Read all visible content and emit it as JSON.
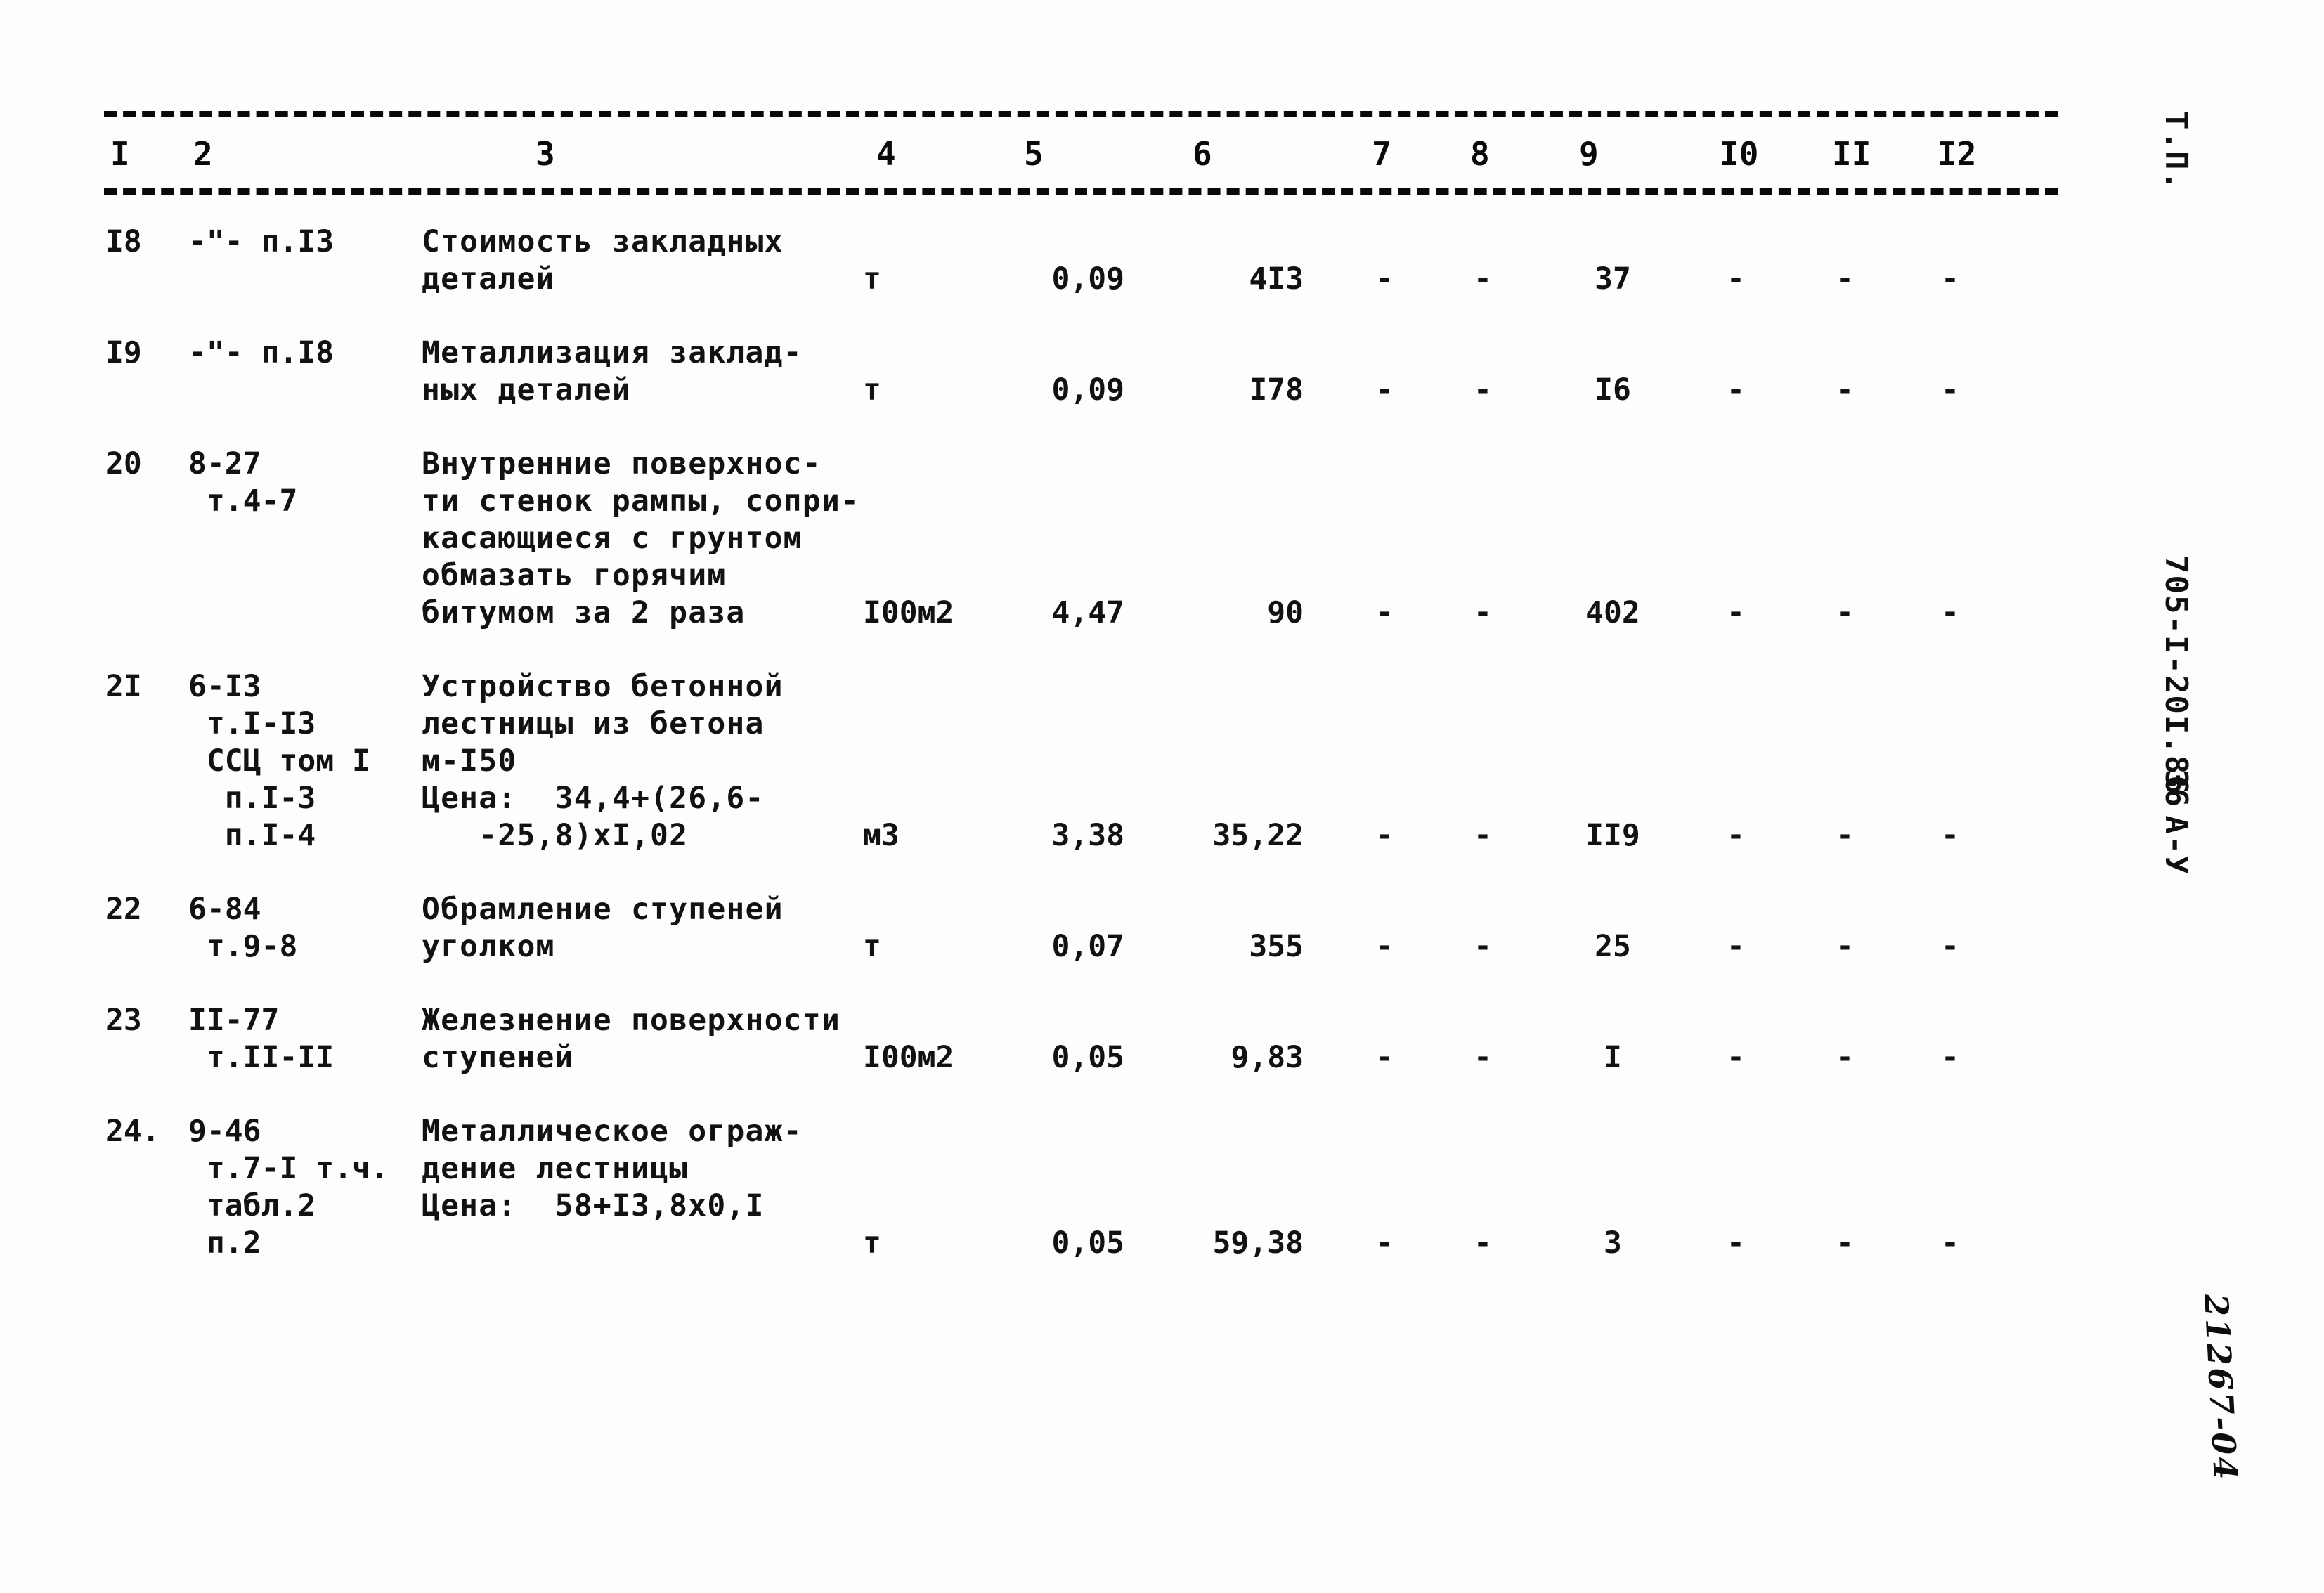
{
  "document": {
    "side_title": "Т.П.",
    "side_mark": "705-I-20I.86  А-У",
    "side_page": "36",
    "handwritten_note": "21267-04"
  },
  "table": {
    "column_headers": [
      "I",
      "2",
      "3",
      "4",
      "5",
      "6",
      "7",
      "8",
      "9",
      "I0",
      "II",
      "I2"
    ],
    "rows": [
      {
        "num": "I8",
        "code": "-\"- п.I3",
        "description": "Стоимость закладных\nдеталей",
        "unit": "т",
        "qty": "0,09",
        "price": "4I3",
        "c7": "-",
        "c8": "-",
        "c9": "37",
        "c10": "-",
        "c11": "-",
        "c12": "-"
      },
      {
        "num": "I9",
        "code": "-\"- п.I8",
        "description": "Металлизация заклад-\nных деталей",
        "unit": "т",
        "qty": "0,09",
        "price": "I78",
        "c7": "-",
        "c8": "-",
        "c9": "I6",
        "c10": "-",
        "c11": "-",
        "c12": "-"
      },
      {
        "num": "20",
        "code": "8-27\n т.4-7",
        "description": "Внутренние поверхнос-\nти стенок рампы, сопри-\nкасающиеся с грунтом\nобмазать горячим\nбитумом за 2 раза",
        "unit": "I00м2",
        "qty": "4,47",
        "price": "90",
        "c7": "-",
        "c8": "-",
        "c9": "402",
        "c10": "-",
        "c11": "-",
        "c12": "-"
      },
      {
        "num": "2I",
        "code": "6-I3\n т.I-I3\n ССЦ том I\n  п.I-3\n  п.I-4",
        "description": "Устройство бетонной\nлестницы из бетона\nм-I50\nЦена:  34,4+(26,6-\n   -25,8)хI,02",
        "unit": "м3",
        "qty": "3,38",
        "price": "35,22",
        "c7": "-",
        "c8": "-",
        "c9": "II9",
        "c10": "-",
        "c11": "-",
        "c12": "-"
      },
      {
        "num": "22",
        "code": "6-84\n т.9-8",
        "description": "Обрамление ступеней\nуголком",
        "unit": "т",
        "qty": "0,07",
        "price": "355",
        "c7": "-",
        "c8": "-",
        "c9": "25",
        "c10": "-",
        "c11": "-",
        "c12": "-"
      },
      {
        "num": "23",
        "code": "II-77\n т.II-II",
        "description": "Железнение поверхности\nступеней",
        "unit": "I00м2",
        "qty": "0,05",
        "price": "9,83",
        "c7": "-",
        "c8": "-",
        "c9": "I",
        "c10": "-",
        "c11": "-",
        "c12": "-"
      },
      {
        "num": "24.",
        "code": "9-46\n т.7-I т.ч.\n табл.2\n п.2",
        "description": "Металлическое ограж-\nдение лестницы\nЦена:  58+I3,8х0,I",
        "unit": "т",
        "qty": "0,05",
        "price": "59,38",
        "c7": "-",
        "c8": "-",
        "c9": "3",
        "c10": "-",
        "c11": "-",
        "c12": "-"
      }
    ]
  }
}
